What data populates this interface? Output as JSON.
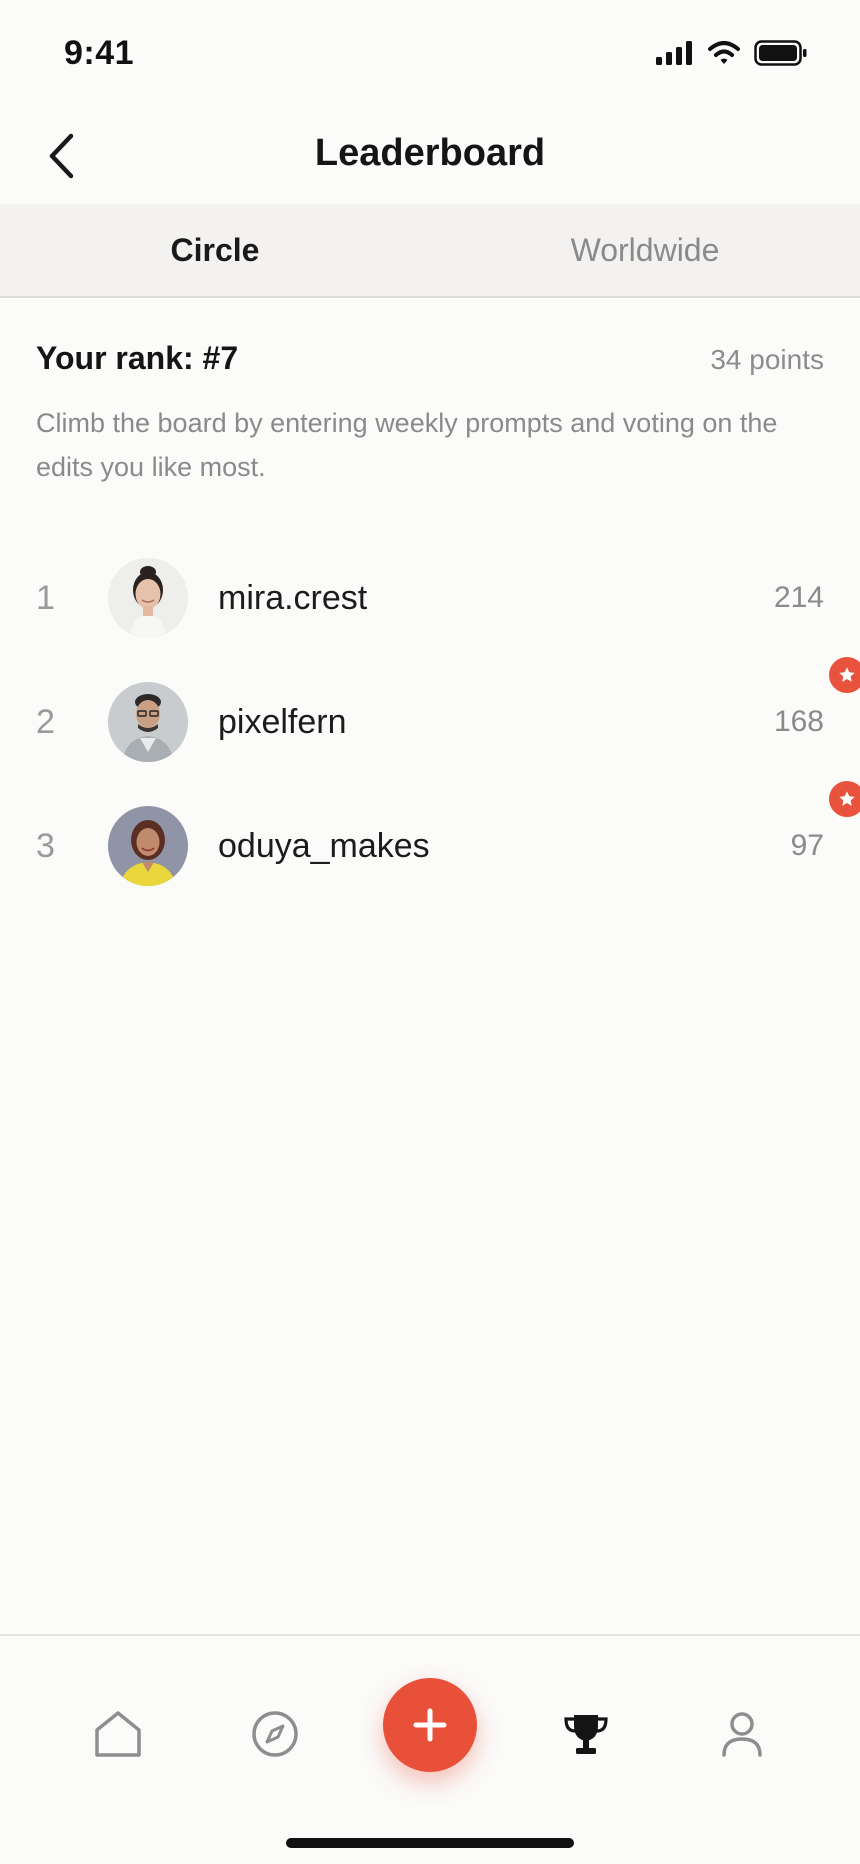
{
  "status_bar": {
    "time": "9:41"
  },
  "header": {
    "title": "Leaderboard"
  },
  "tabs": [
    {
      "label": "Circle",
      "active": true
    },
    {
      "label": "Worldwide",
      "active": false
    }
  ],
  "rank": {
    "label": "Your rank: #7",
    "points": "34 points",
    "description": "Climb the board by entering weekly prompts and voting on the edits you like most."
  },
  "leaders": [
    {
      "rank": "1",
      "name": "mira.crest",
      "score": "214",
      "badge": false
    },
    {
      "rank": "2",
      "name": "pixelfern",
      "score": "168",
      "badge": true
    },
    {
      "rank": "3",
      "name": "oduya_makes",
      "score": "97",
      "badge": true
    }
  ],
  "bottom_nav": {
    "items": [
      "home-icon",
      "compass-icon",
      "plus-icon",
      "trophy-icon",
      "profile-icon"
    ],
    "active": "trophy-icon"
  },
  "colors": {
    "accent": "#e9503a",
    "text_primary": "#1a1a1a",
    "text_secondary": "#8a8a8a",
    "tab_bg": "#f3f2f0",
    "background": "#fbfbfa"
  }
}
